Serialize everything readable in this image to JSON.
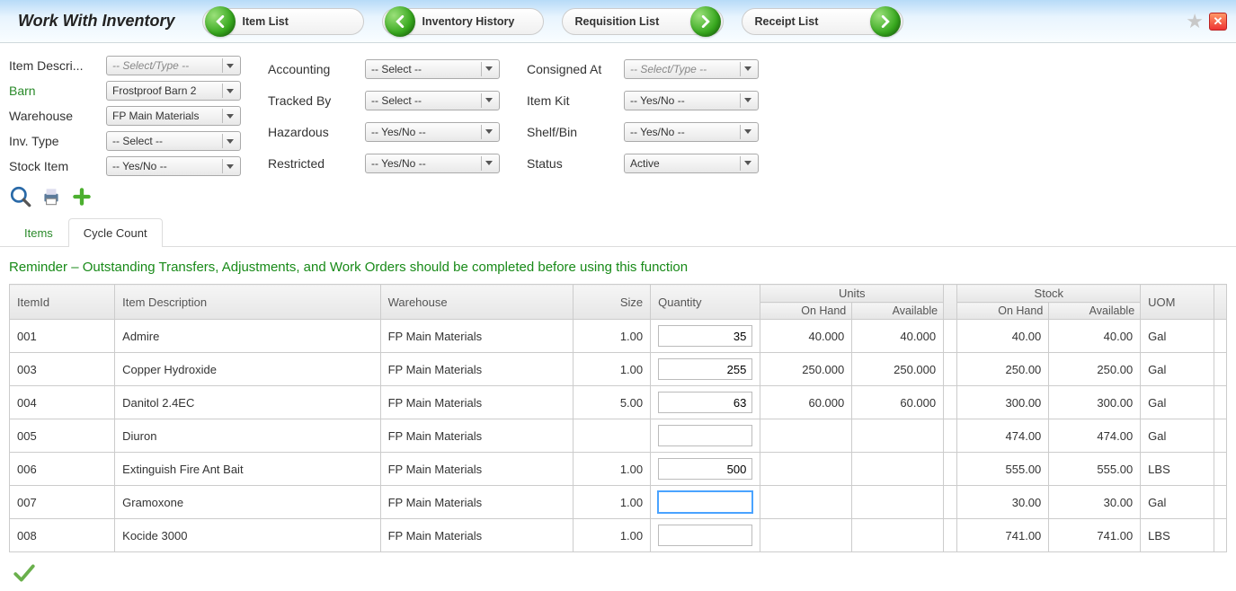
{
  "header": {
    "title": "Work With Inventory",
    "nav": [
      {
        "label": "Item List",
        "dir": "left"
      },
      {
        "label": "Inventory History",
        "dir": "left"
      },
      {
        "label": "Requisition List",
        "dir": "right"
      },
      {
        "label": "Receipt List",
        "dir": "right"
      }
    ]
  },
  "filters": {
    "col1": {
      "item_desc_label": "Item Descri...",
      "item_desc_value": "-- Select/Type --",
      "barn_label": "Barn",
      "barn_value": "Frostproof Barn 2",
      "warehouse_label": "Warehouse",
      "warehouse_value": "FP Main Materials",
      "inv_type_label": "Inv. Type",
      "inv_type_value": "-- Select --",
      "stock_item_label": "Stock Item",
      "stock_item_value": "-- Yes/No --"
    },
    "col2": {
      "accounting_label": "Accounting",
      "accounting_value": "-- Select --",
      "tracked_by_label": "Tracked By",
      "tracked_by_value": "-- Select --",
      "hazardous_label": "Hazardous",
      "hazardous_value": "-- Yes/No --",
      "restricted_label": "Restricted",
      "restricted_value": "-- Yes/No --"
    },
    "col3": {
      "consigned_label": "Consigned At",
      "consigned_value": "-- Select/Type --",
      "item_kit_label": "Item Kit",
      "item_kit_value": "-- Yes/No --",
      "shelf_label": "Shelf/Bin",
      "shelf_value": "-- Yes/No --",
      "status_label": "Status",
      "status_value": "Active"
    }
  },
  "tabs": {
    "items": "Items",
    "cycle_count": "Cycle Count"
  },
  "reminder": "Reminder – Outstanding Transfers, Adjustments, and Work Orders should be completed before using this function",
  "grid": {
    "headers": {
      "item_id": "ItemId",
      "item_desc": "Item Description",
      "warehouse": "Warehouse",
      "size": "Size",
      "quantity": "Quantity",
      "units": "Units",
      "units_onhand": "On Hand",
      "units_avail": "Available",
      "stock": "Stock",
      "stock_onhand": "On Hand",
      "stock_avail": "Available",
      "uom": "UOM"
    },
    "rows": [
      {
        "id": "001",
        "desc": "Admire",
        "wh": "FP Main Materials",
        "size": "1.00",
        "qty": "35",
        "u_on": "40.000",
        "u_av": "40.000",
        "s_on": "40.00",
        "s_av": "40.00",
        "uom": "Gal"
      },
      {
        "id": "003",
        "desc": "Copper Hydroxide",
        "wh": "FP Main Materials",
        "size": "1.00",
        "qty": "255",
        "u_on": "250.000",
        "u_av": "250.000",
        "s_on": "250.00",
        "s_av": "250.00",
        "uom": "Gal"
      },
      {
        "id": "004",
        "desc": "Danitol 2.4EC",
        "wh": "FP Main Materials",
        "size": "5.00",
        "qty": "63",
        "u_on": "60.000",
        "u_av": "60.000",
        "s_on": "300.00",
        "s_av": "300.00",
        "uom": "Gal"
      },
      {
        "id": "005",
        "desc": "Diuron",
        "wh": "FP Main Materials",
        "size": "",
        "qty": "",
        "u_on": "",
        "u_av": "",
        "s_on": "474.00",
        "s_av": "474.00",
        "uom": "Gal"
      },
      {
        "id": "006",
        "desc": "Extinguish Fire Ant Bait",
        "wh": "FP Main Materials",
        "size": "1.00",
        "qty": "500",
        "u_on": "",
        "u_av": "",
        "s_on": "555.00",
        "s_av": "555.00",
        "uom": "LBS"
      },
      {
        "id": "007",
        "desc": "Gramoxone",
        "wh": "FP Main Materials",
        "size": "1.00",
        "qty": "",
        "u_on": "",
        "u_av": "",
        "s_on": "30.00",
        "s_av": "30.00",
        "uom": "Gal",
        "focused": true
      },
      {
        "id": "008",
        "desc": "Kocide 3000",
        "wh": "FP Main Materials",
        "size": "1.00",
        "qty": "",
        "u_on": "",
        "u_av": "",
        "s_on": "741.00",
        "s_av": "741.00",
        "uom": "LBS"
      }
    ]
  }
}
